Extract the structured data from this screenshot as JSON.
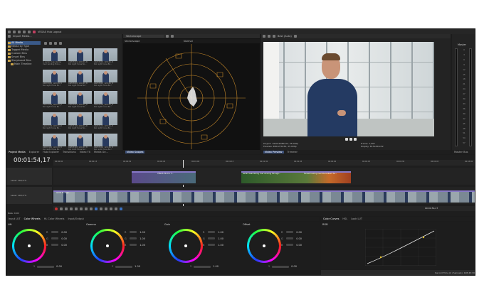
{
  "app": {
    "title": "VEGAS Hub Logout"
  },
  "explorer": {
    "title": "Import Media...",
    "tree": [
      "All Media",
      "Media by Type",
      "Tagged Media",
      "Custom Bins",
      "Smart Bins",
      "Storyboard Bins",
      "Main Timeline"
    ],
    "thumbs": [
      {
        "c1": "A_aerial meandering",
        "c2": "river winding throu..."
      },
      {
        "c1": "A0ZX3091_120101_B",
        "c2": "KIA night hi-res Bo..."
      },
      {
        "c1": "A0ZX3092_120101_B",
        "c2": "KIA night hi-res Bo..."
      },
      {
        "c1": "A0ZX3093_120101_B",
        "c2": "KIA night hi-res Bo..."
      },
      {
        "c1": "A0ZX3094_120101_B",
        "c2": "KIA night hi-res Bo..."
      },
      {
        "c1": "A0ZX3095_120101_B",
        "c2": "KIA night hi-res Bo..."
      },
      {
        "c1": "A0ZX3096_120101_B",
        "c2": "KIA night hi-res Bo..."
      },
      {
        "c1": "A0ZX3097_120101_B",
        "c2": "KIA night hi-res Bo..."
      },
      {
        "c1": "A0ZX3098_120101_B",
        "c2": "KIA night hi-res Bo..."
      },
      {
        "c1": "A0ZX3099_120101_B",
        "c2": "KIA night hi-res Bo..."
      },
      {
        "c1": "A0ZX3100_120101_B",
        "c2": "KIA night hi-res Bo..."
      },
      {
        "c1": "A0ZX3101_120101_B",
        "c2": "KIA night hi-res Bo..."
      },
      {
        "c1": "A0ZX3102_120101_B",
        "c2": "KIA night hi-res Bo..."
      },
      {
        "c1": "A0ZX3103_120101_B",
        "c2": "KIA night hi-res Bo..."
      },
      {
        "c1": "A0ZX3104_120101_B",
        "c2": "KIA night hi-res Bo..."
      }
    ],
    "tabs": [
      "Project Media",
      "Explorer",
      "Hub Explorer",
      "Transitions",
      "Video FX",
      "Media Ge..."
    ]
  },
  "scopes": {
    "dropdown": "Vectorscope",
    "panel_title": "Vectorscope",
    "mode": "Normal",
    "tab": "Video Scopes"
  },
  "preview": {
    "mode": "Best (Auto)",
    "project": "Project: 1920x1080x32, 25.000p",
    "preview_res": "Preview: 480x270x32, 25.000p",
    "frame": "Frame: 1,967",
    "display": "Display: 813x264x32",
    "tabs": [
      "Video Preview",
      "Trimmer"
    ]
  },
  "master": {
    "title": "Master",
    "tab": "Master Bus",
    "scale": [
      "0",
      "3",
      "6",
      "9",
      "12",
      "15",
      "18",
      "21",
      "24",
      "27",
      "30",
      "33",
      "36",
      "39",
      "42",
      "45",
      "48",
      "51",
      "54",
      "57"
    ]
  },
  "timeline": {
    "timecode": "00:01:54,17",
    "level1": "Level: 100,0 %",
    "level2": "Level: 100,0 %",
    "rate": "Rate: 0,00",
    "end_time": "00:01:54,17",
    "ruler": [
      "00:00:00",
      "00:00:15",
      "00:00:30",
      "00:00:45",
      "00:01:00",
      "00:01:15",
      "00:01:30",
      "00:01:45",
      "00:02:00",
      "00:02:15",
      "00:02:30",
      "00:02:45",
      "00:03:00"
    ],
    "clips": [
      "VEGAS Pilot to T...",
      "aerial meandering river winding through...",
      "aerial footage...",
      "Sunset looking over the brilliant he..."
    ]
  },
  "color": {
    "tabs": [
      "Input LUT",
      "Color Wheels",
      "HL Color Wheels",
      "Input/Output"
    ],
    "right_tabs": [
      "Color Curves",
      "HSL",
      "Look LUT"
    ],
    "curve_label": "RGB",
    "wheels": [
      {
        "name": "Lift",
        "r": "0.00",
        "g": "0.00",
        "b": "0.00",
        "y": "0.00"
      },
      {
        "name": "Gamma",
        "r": "1.00",
        "g": "1.00",
        "b": "1.00",
        "y": "1.00"
      },
      {
        "name": "Gain",
        "r": "1.00",
        "g": "1.00",
        "b": "1.00",
        "y": "1.00"
      },
      {
        "name": "Offset",
        "r": "0.00",
        "g": "0.00",
        "b": "0.00",
        "y": "0.00"
      }
    ]
  },
  "status": {
    "record_time": "Record Time (2 channels): 198:45:30"
  }
}
